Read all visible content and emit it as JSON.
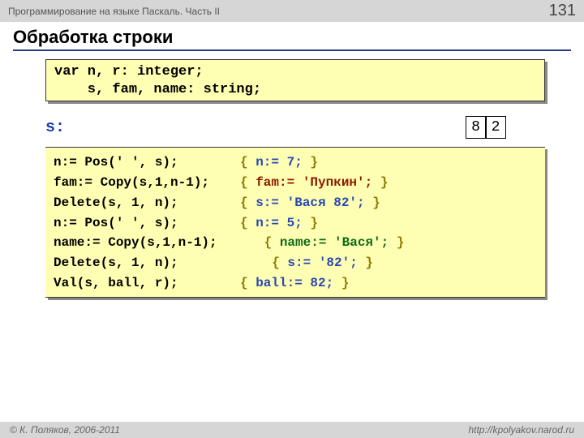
{
  "header": {
    "course": "Программирование на языке Паскаль. Часть II",
    "page": "131"
  },
  "title": "Обработка строки",
  "decl": "var n, r: integer;\n    s, fam, name: string;",
  "s_label": "s:",
  "cells": [
    "8",
    "2"
  ],
  "code": [
    {
      "stmt": "n:= Pos(' ', s);",
      "b1": "{ ",
      "v": "n:= 7;",
      "cls": "cmt-blue",
      "b2": " }"
    },
    {
      "stmt": "fam:= Copy(s,1,n-1);",
      "b1": "{ ",
      "v": "fam:= 'Пупкин';",
      "cls": "cmt-darkred",
      "b2": " }"
    },
    {
      "stmt": "Delete(s, 1, n);",
      "b1": "{ ",
      "v": "s:= 'Вася 82';",
      "cls": "cmt-blue",
      "b2": " }"
    },
    {
      "stmt": "n:= Pos(' ', s);",
      "b1": "{ ",
      "v": "n:= 5;",
      "cls": "cmt-blue",
      "b2": " }"
    },
    {
      "stmt": "name:= Copy(s,1,n-1);",
      "b1": " { ",
      "v": "name:= 'Вася';",
      "cls": "cmt-green",
      "b2": " }",
      "wide": true
    },
    {
      "stmt": "Delete(s, 1, n);",
      "b1": "  { ",
      "v": "s:= '82';",
      "cls": "cmt-blue",
      "b2": " }",
      "wide": true
    },
    {
      "stmt": "Val(s, ball, r);",
      "b1": "{ ",
      "v": "ball:= 82;",
      "cls": "cmt-blue",
      "b2": " }"
    }
  ],
  "footer": {
    "left": "© К. Поляков, 2006-2011",
    "right": "http://kpolyakov.narod.ru"
  }
}
